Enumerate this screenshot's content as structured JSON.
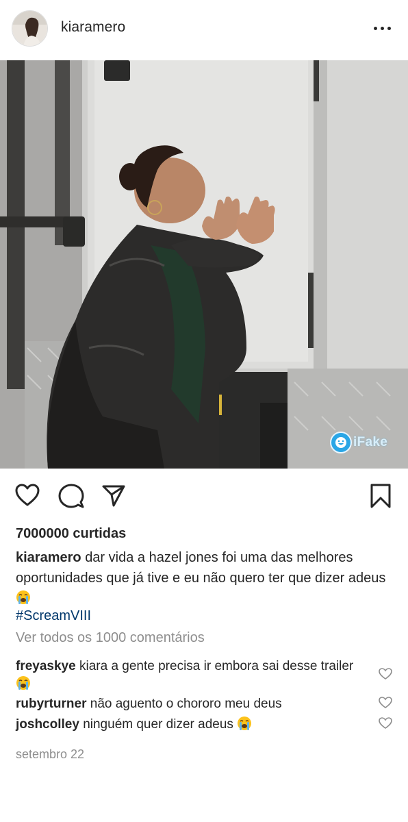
{
  "header": {
    "username": "kiaramero",
    "avatar_icon": "avatar-photo",
    "more_icon": "more-horizontal-icon"
  },
  "photo": {
    "description_icon": "post-photo",
    "watermark": "iFake"
  },
  "actions": {
    "like_icon": "heart-icon",
    "comment_icon": "comment-icon",
    "share_icon": "send-icon",
    "save_icon": "bookmark-icon"
  },
  "post": {
    "likes": "7000000 curtidas",
    "caption_user": "kiaramero",
    "caption_text": "dar vida a hazel jones foi uma das melhores oportunidades que já tive e eu não quero ter que dizer adeus",
    "hashtag": "#ScreamVIII",
    "view_all": "Ver todos os 1000 comentários",
    "date": "setembro 22"
  },
  "comments": [
    {
      "user": "freyaskye",
      "text": "kiara a gente precisa ir embora sai desse trailer"
    },
    {
      "user": "rubyrturner",
      "text": "não aguento o chororo meu deus"
    },
    {
      "user": "joshcolley",
      "text": "ninguém quer dizer adeus"
    }
  ],
  "colors": {
    "text": "#262626",
    "muted": "#8e8e8e",
    "hashtag": "#00376b",
    "watermark": "#2aa6e6"
  }
}
